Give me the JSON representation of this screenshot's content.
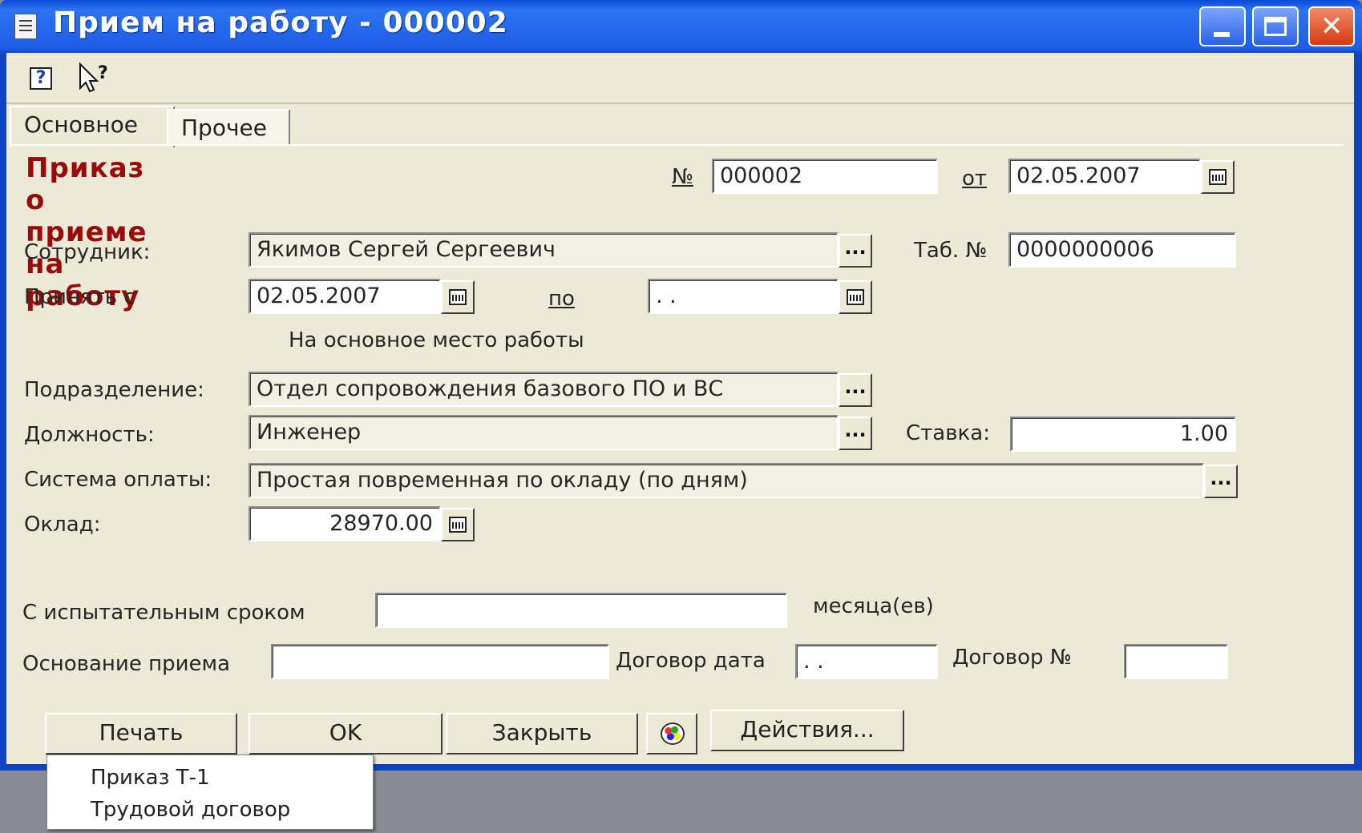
{
  "window": {
    "title": "Прием на работу - 000002"
  },
  "toolbar": {
    "help_icon": "help-icon",
    "whatsthis_icon": "whats-this-icon"
  },
  "tabs": [
    {
      "label": "Основное",
      "active": true
    },
    {
      "label": "Прочее",
      "active": false
    }
  ],
  "form": {
    "heading": "Приказ о приеме на работу",
    "number_label": "№",
    "number_value": "000002",
    "date_label": "от",
    "date_value": "02.05.2007",
    "employee_label": "Сотрудник:",
    "employee_value": "Якимов Сергей Сергеевич",
    "tab_no_label": "Таб. №",
    "tab_no_value": "0000000006",
    "hire_from_label": "Принять с",
    "hire_from_value": "02.05.2007",
    "hire_to_label": "по",
    "hire_to_value": " .  .",
    "main_job_label": "На основное место работы",
    "main_job_checked": true,
    "department_label": "Подразделение:",
    "department_value": "Отдел сопровождения базового ПО и ВС",
    "position_label": "Должность:",
    "position_value": "Инженер",
    "rate_label": "Ставка:",
    "rate_value": "1.00",
    "payment_label": "Система оплаты:",
    "payment_value": "Простая повременная по окладу (по дням)",
    "salary_label": "Оклад:",
    "salary_value": "28970.00",
    "probation_label": "С испытательным сроком",
    "probation_value": "",
    "months_label": "месяца(ев)",
    "basis_label": "Основание приема",
    "basis_value": "",
    "contract_date_label": "Договор дата",
    "contract_date_value": " .  .",
    "contract_no_label": "Договор №",
    "contract_no_value": ""
  },
  "buttons": {
    "print": "Печать",
    "ok": "OK",
    "close": "Закрыть",
    "actions": "Действия..."
  },
  "print_menu": [
    {
      "label": "Приказ Т-1"
    },
    {
      "label": "Трудовой договор"
    }
  ],
  "colors": {
    "titlebar": "#1f5ee6",
    "heading": "#9b0a0a",
    "face": "#ece9d6"
  }
}
